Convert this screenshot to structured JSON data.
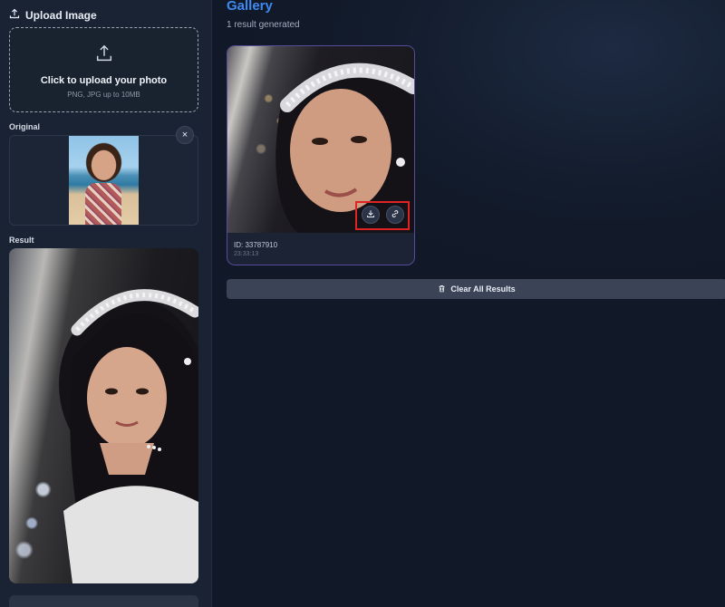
{
  "sidebar": {
    "upload_heading": "Upload Image",
    "dropzone_title": "Click to upload your photo",
    "dropzone_hint": "PNG, JPG up to 10MB",
    "original_label": "Original",
    "result_label": "Result",
    "close_glyph": "×"
  },
  "gallery": {
    "title": "Gallery",
    "count_text": "1 result generated",
    "card": {
      "id_text": "ID: 33787910",
      "time_text": "23:33:13"
    },
    "clear_label": "Clear All Results"
  },
  "colors": {
    "accent": "#3d8bf2",
    "highlight": "#e02424",
    "card_border": "#5b4c9a"
  },
  "icons": [
    "upload-icon",
    "close-icon",
    "download-icon",
    "link-icon",
    "trash-icon"
  ]
}
